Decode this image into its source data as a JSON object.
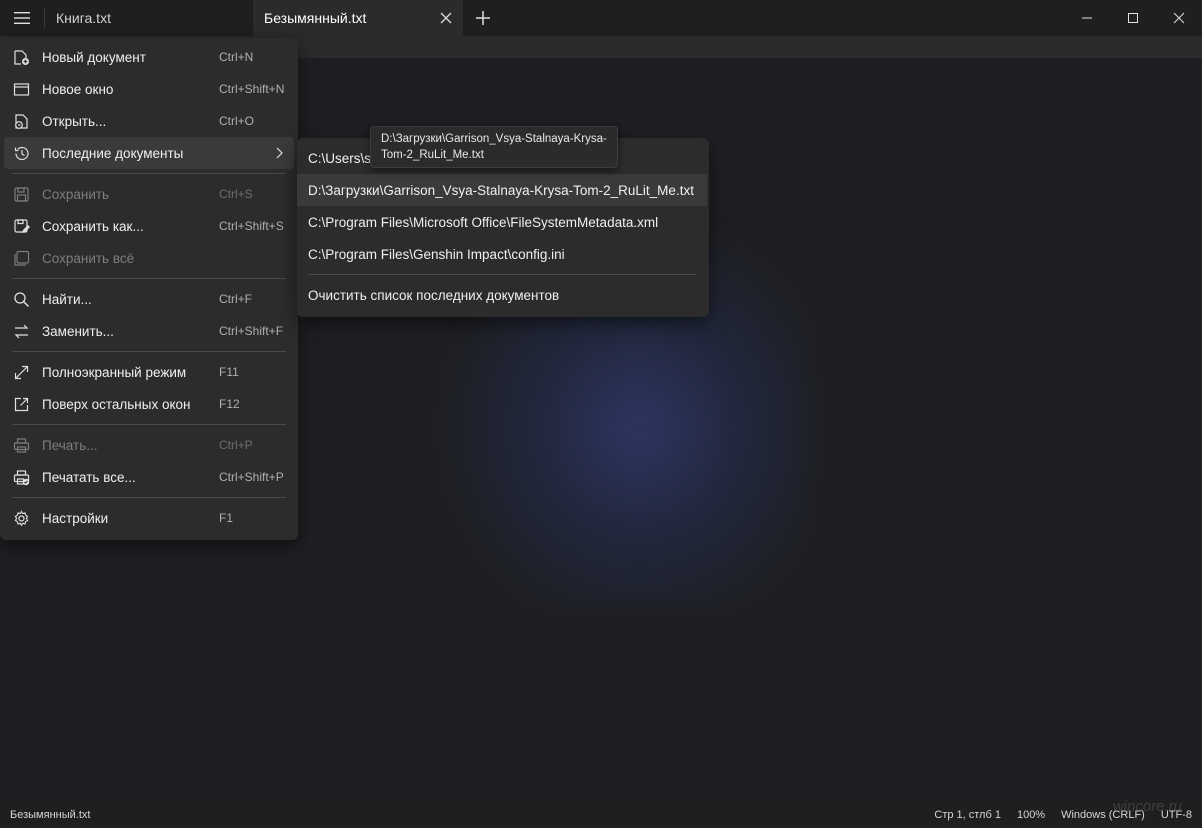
{
  "tabs": [
    {
      "label": "Книга.txt",
      "active": false
    },
    {
      "label": "Безымянный.txt",
      "active": true
    }
  ],
  "menu": {
    "items": [
      {
        "label": "Новый документ",
        "shortcut": "Ctrl+N",
        "icon": "new-document-icon"
      },
      {
        "label": "Новое окно",
        "shortcut": "Ctrl+Shift+N",
        "icon": "new-window-icon"
      },
      {
        "label": "Открыть...",
        "shortcut": "Ctrl+O",
        "icon": "open-icon"
      },
      {
        "label": "Последние документы",
        "shortcut": "",
        "icon": "history-icon"
      },
      {
        "label": "Сохранить",
        "shortcut": "Ctrl+S",
        "icon": "save-icon"
      },
      {
        "label": "Сохранить как...",
        "shortcut": "Ctrl+Shift+S",
        "icon": "save-as-icon"
      },
      {
        "label": "Сохранить всё",
        "shortcut": "",
        "icon": "save-all-icon"
      },
      {
        "label": "Найти...",
        "shortcut": "Ctrl+F",
        "icon": "search-icon"
      },
      {
        "label": "Заменить...",
        "shortcut": "Ctrl+Shift+F",
        "icon": "replace-icon"
      },
      {
        "label": "Полноэкранный режим",
        "shortcut": "F11",
        "icon": "fullscreen-icon"
      },
      {
        "label": "Поверх остальных окон",
        "shortcut": "F12",
        "icon": "always-on-top-icon"
      },
      {
        "label": "Печать...",
        "shortcut": "Ctrl+P",
        "icon": "print-icon"
      },
      {
        "label": "Печатать все...",
        "shortcut": "Ctrl+Shift+P",
        "icon": "print-all-icon"
      },
      {
        "label": "Настройки",
        "shortcut": "F1",
        "icon": "gear-icon"
      }
    ]
  },
  "recent": {
    "items": [
      "C:\\Users\\s",
      "D:\\Загрузки\\Garrison_Vsya-Stalnaya-Krysa-Tom-2_RuLit_Me.txt",
      "C:\\Program Files\\Microsoft Office\\FileSystemMetadata.xml",
      "C:\\Program Files\\Genshin Impact\\config.ini"
    ],
    "clear_label": "Очистить список последних документов"
  },
  "tooltip": {
    "line1": "D:\\Загрузки\\Garrison_Vsya-Stalnaya-Krysa-",
    "line2": "Tom-2_RuLit_Me.txt"
  },
  "status": {
    "filename": "Безымянный.txt",
    "position": "Стр 1, стлб 1",
    "zoom": "100%",
    "line_ending": "Windows (CRLF)",
    "encoding": "UTF-8"
  },
  "watermark": "wincore.ru"
}
